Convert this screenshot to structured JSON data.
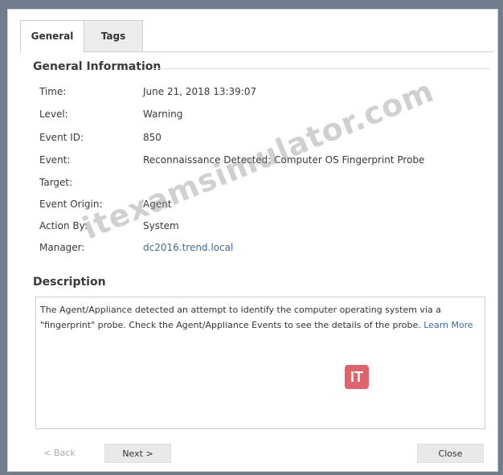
{
  "tabs": [
    {
      "label": "General",
      "active": true
    },
    {
      "label": "Tags",
      "active": false
    }
  ],
  "general": {
    "title": "General Information",
    "fields": [
      {
        "label": "Time:",
        "value": "June 21, 2018 13:39:07"
      },
      {
        "label": "Level:",
        "value": "Warning"
      },
      {
        "label": "Event ID:",
        "value": "850"
      },
      {
        "label": "Event:",
        "value": "Reconnaissance Detected: Computer OS Fingerprint Probe"
      },
      {
        "label": "Target:",
        "value": ""
      },
      {
        "label": "Event Origin:",
        "value": "Agent"
      },
      {
        "label": "Action By:",
        "value": "System"
      },
      {
        "label": "Manager:",
        "value": "dc2016.trend.local"
      }
    ]
  },
  "description": {
    "title": "Description",
    "text": "The Agent/Appliance detected an attempt to identify the computer operating system via a \"fingerprint\" probe. Check the Agent/Appliance Events to see the details of the probe.",
    "link": "Learn More"
  },
  "buttons": {
    "back": "< Back",
    "next": "Next >",
    "close": "Close"
  },
  "watermark": "itexamsimulator.com",
  "logo": "IT",
  "colors": {
    "link": "#3d6aa8",
    "logo": "#e0626a"
  }
}
